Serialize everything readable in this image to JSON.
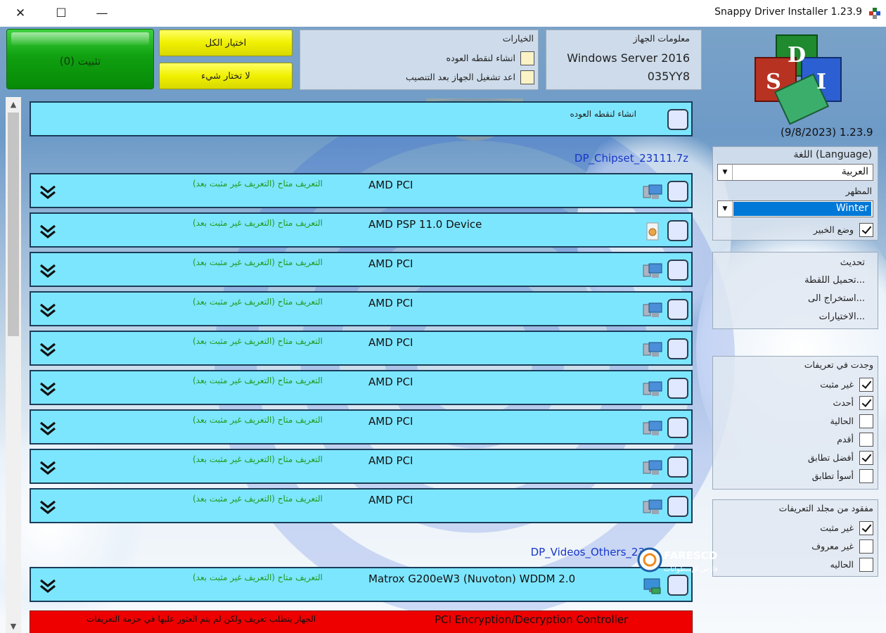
{
  "window": {
    "title": "Snappy Driver Installer 1.23.9",
    "close_glyph": "✕",
    "maximize_glyph": "☐",
    "minimize_glyph": "—"
  },
  "toolbar": {
    "install_label": "تثبيت (0)",
    "select_all_label": "اختيار الكل",
    "select_none_label": "لا تختار شيء"
  },
  "options_panel": {
    "title": "الخيارات",
    "restore_point_label": "انشاء لنقطه العوده",
    "restart_label": "اعد تشغيل الجهاز بعد التنصيب"
  },
  "device_info": {
    "title": "معلومات الجهاز",
    "os": "Windows Server 2016",
    "model": "035YY8"
  },
  "logo": {
    "letters": [
      "D",
      "S",
      "I"
    ],
    "version": "(9/8/2023) 1.23.9"
  },
  "sidebar": {
    "language_label": "اللغة (Language)",
    "language_value": "العربية",
    "theme_label": "المظهر",
    "theme_value": "Winter",
    "expert_label": "وضع الخبير",
    "expert_checked": true,
    "menu": [
      "تحديث",
      "تحميل اللقطة...",
      "استخراج الى...",
      "الاختيارات..."
    ],
    "found_title": "وجدت في تعريفات",
    "found_filters": [
      {
        "label": "غير مثبت",
        "checked": true
      },
      {
        "label": "أحدث",
        "checked": true
      },
      {
        "label": "الحالية",
        "checked": false
      },
      {
        "label": "أقدم",
        "checked": false
      },
      {
        "label": "أفضل تطابق",
        "checked": true
      },
      {
        "label": "أسوأ تطابق",
        "checked": false
      }
    ],
    "missing_title": "مفقود من مجلد التعريفات",
    "missing_filters": [
      {
        "label": "غير مثبت",
        "checked": true
      },
      {
        "label": "غير معروف",
        "checked": false
      },
      {
        "label": "الحاليه",
        "checked": false
      }
    ]
  },
  "list": {
    "restore_row_label": "انشاء لنقطه العوده",
    "packs": [
      {
        "name": "DP_Chipset_23111.7z",
        "drivers": [
          {
            "name": "AMD PCI",
            "status": "التعريف متاح (التعريف غير مثبت بعد)",
            "icon": "pci-device-icon"
          },
          {
            "name": "AMD PSP 11.0 Device",
            "status": "التعريف متاح (التعريف غير مثبت بعد)",
            "icon": "system-device-icon"
          },
          {
            "name": "AMD PCI",
            "status": "التعريف متاح (التعريف غير مثبت بعد)",
            "icon": "pci-device-icon"
          },
          {
            "name": "AMD PCI",
            "status": "التعريف متاح (التعريف غير مثبت بعد)",
            "icon": "pci-device-icon"
          },
          {
            "name": "AMD PCI",
            "status": "التعريف متاح (التعريف غير مثبت بعد)",
            "icon": "pci-device-icon"
          },
          {
            "name": "AMD PCI",
            "status": "التعريف متاح (التعريف غير مثبت بعد)",
            "icon": "pci-device-icon"
          },
          {
            "name": "AMD PCI",
            "status": "التعريف متاح (التعريف غير مثبت بعد)",
            "icon": "pci-device-icon"
          },
          {
            "name": "AMD PCI",
            "status": "التعريف متاح (التعريف غير مثبت بعد)",
            "icon": "pci-device-icon"
          },
          {
            "name": "AMD PCI",
            "status": "التعريف متاح (التعريف غير مثبت بعد)",
            "icon": "pci-device-icon"
          }
        ]
      },
      {
        "name": "DP_Videos_Others_23",
        "drivers": [
          {
            "name": "Matrox G200eW3 (Nuvoton) WDDM 2.0",
            "status": "التعريف متاح (التعريف غير مثبت بعد)",
            "icon": "display-adapter-icon"
          }
        ]
      }
    ],
    "missing_driver": {
      "name": "PCI Encryption/Decryption Controller",
      "status": "الجهاز يتطلب تعريف ولكن لم يتم العثور عليها في حزمة التعريفات"
    }
  },
  "brand": {
    "name": "FARESCD",
    "tagline": "فارس للإسطوانات"
  },
  "colors": {
    "row_bg": "#7de6ff",
    "install_green": "#10a010",
    "select_yellow": "#f0f000",
    "status_green": "#1f9a1f",
    "missing_red": "#ee0000",
    "pack_blue": "#1536c8"
  }
}
